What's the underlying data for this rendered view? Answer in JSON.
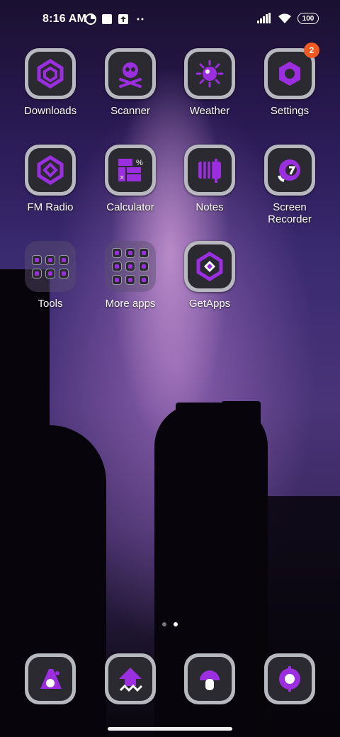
{
  "status_bar": {
    "time": "8:16 AM",
    "battery_level": "100",
    "icons_left": [
      "data-saver-icon",
      "square-notification-icon",
      "upload-notification-icon",
      "more-notifications-icon"
    ],
    "icons_right": [
      "signal-icon",
      "wifi-icon",
      "battery-icon"
    ]
  },
  "apps": [
    {
      "label": "Downloads",
      "icon": "downloads-icon"
    },
    {
      "label": "Scanner",
      "icon": "scanner-icon"
    },
    {
      "label": "Weather",
      "icon": "weather-icon"
    },
    {
      "label": "Settings",
      "icon": "settings-icon",
      "badge": "2"
    },
    {
      "label": "FM Radio",
      "icon": "fm-radio-icon"
    },
    {
      "label": "Calculator",
      "icon": "calculator-icon"
    },
    {
      "label": "Notes",
      "icon": "notes-icon"
    },
    {
      "label_line1": "Screen",
      "label_line2": "Recorder",
      "icon": "screen-recorder-icon"
    },
    {
      "label": "Tools",
      "icon": "folder-icon"
    },
    {
      "label": "More apps",
      "icon": "folder-icon"
    },
    {
      "label": "GetApps",
      "icon": "getapps-icon"
    }
  ],
  "dock": [
    {
      "icon": "phone-icon"
    },
    {
      "icon": "messaging-icon"
    },
    {
      "icon": "browser-icon"
    },
    {
      "icon": "camera-icon"
    }
  ],
  "page_indicator": {
    "pages": 2,
    "active": 2
  },
  "colors": {
    "accent": "#9b2fe0",
    "badge": "#f15a22",
    "icon_bg": "#2b2a30",
    "icon_frame": "#b8b8c0"
  }
}
